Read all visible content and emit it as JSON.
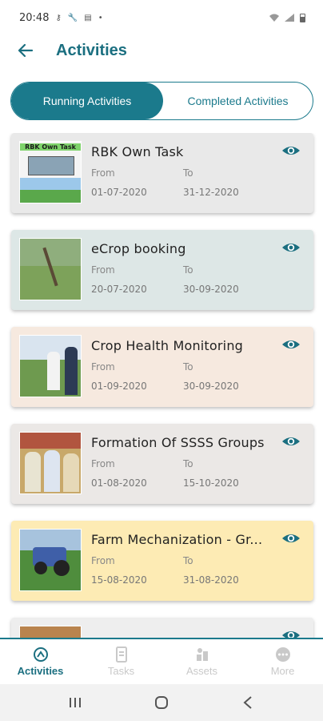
{
  "status_bar": {
    "time": "20:48",
    "left_icons": [
      "key-icon",
      "wrench-icon",
      "message-icon"
    ],
    "dot": "•",
    "right_icons": [
      "wifi-icon",
      "signal-icon",
      "battery-icon"
    ]
  },
  "app_bar": {
    "title": "Activities",
    "back_icon": "back-arrow-icon"
  },
  "tabs": [
    {
      "label": "Running Activities",
      "active": true
    },
    {
      "label": "Completed Activities",
      "active": false
    }
  ],
  "activities": [
    {
      "title": "RBK Own Task",
      "from_label": "From",
      "to_label": "To",
      "from": "01-07-2020",
      "to": "31-12-2020",
      "bg": "#e9e9e9",
      "thumb_text": "RBK Own Task"
    },
    {
      "title": "eCrop booking",
      "from_label": "From",
      "to_label": "To",
      "from": "20-07-2020",
      "to": "30-09-2020",
      "bg": "#dde7e6"
    },
    {
      "title": "Crop Health Monitoring",
      "from_label": "From",
      "to_label": "To",
      "from": "01-09-2020",
      "to": "30-09-2020",
      "bg": "#f6e9df"
    },
    {
      "title": "Formation Of SSSS Groups",
      "from_label": "From",
      "to_label": "To",
      "from": "01-08-2020",
      "to": "15-10-2020",
      "bg": "#ebe8e6"
    },
    {
      "title": "Farm Mechanization - Gr...",
      "from_label": "From",
      "to_label": "To",
      "from": "15-08-2020",
      "to": "31-08-2020",
      "bg": "#fdebb4"
    }
  ],
  "bottom_nav": [
    {
      "label": "Activities",
      "icon": "activities-icon",
      "active": true
    },
    {
      "label": "Tasks",
      "icon": "tasks-icon",
      "active": false
    },
    {
      "label": "Assets",
      "icon": "assets-icon",
      "active": false
    },
    {
      "label": "More",
      "icon": "more-icon",
      "active": false
    }
  ],
  "colors": {
    "accent": "#1b7a8c",
    "title": "#1b6f80",
    "inactive_nav": "#c9c9c9"
  }
}
